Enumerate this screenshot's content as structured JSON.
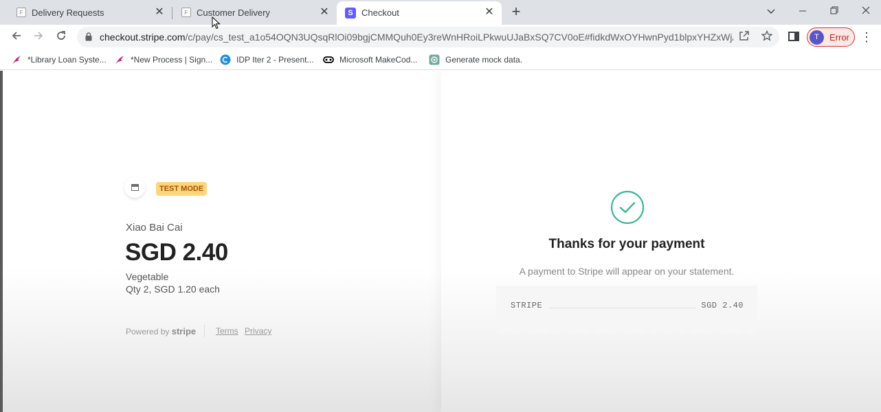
{
  "tabs": [
    {
      "title": "Delivery Requests",
      "icon": "form-icon",
      "active": false
    },
    {
      "title": "Customer Delivery",
      "icon": "form-icon",
      "active": false
    },
    {
      "title": "Checkout",
      "icon": "stripe-icon",
      "active": true
    }
  ],
  "toolbar": {
    "url_host": "checkout.stripe.com",
    "url_path": "/c/pay/cs_test_a1o54OQN3UQsqRlOi09bgjCMMQuh0Ey3reWnHRoiLPkwuUJaBxSQ7CV0oE#fidkdWxOYHwnPyd1blpxYHZxWjA0...",
    "profile_initial": "T",
    "profile_status": "Error"
  },
  "bookmarks": [
    {
      "label": "*Library Loan Syste...",
      "icon": "power-apps-icon"
    },
    {
      "label": "*New Process | Sign...",
      "icon": "power-apps-icon"
    },
    {
      "label": "IDP Iter 2 - Present...",
      "icon": "canva-icon"
    },
    {
      "label": "Microsoft MakeCod...",
      "icon": "makecode-icon"
    },
    {
      "label": "Generate mock data.",
      "icon": "openai-icon"
    }
  ],
  "checkout": {
    "test_mode_label": "TEST MODE",
    "product_name": "Xiao Bai Cai",
    "price": "SGD 2.40",
    "description": "Vegetable",
    "quantity": "Qty 2, SGD 1.20 each",
    "powered_by": "Powered by",
    "powered_brand": "stripe",
    "terms": "Terms",
    "privacy": "Privacy"
  },
  "confirmation": {
    "title": "Thanks for your payment",
    "statement": "A payment to Stripe will appear on your statement.",
    "merchant": "STRIPE",
    "amount": "SGD 2.40"
  },
  "colors": {
    "stripe_brand": "#635bff",
    "success_green": "#3ab795",
    "test_mode_bg": "#ffd57a",
    "profile_error": "#d93025"
  }
}
